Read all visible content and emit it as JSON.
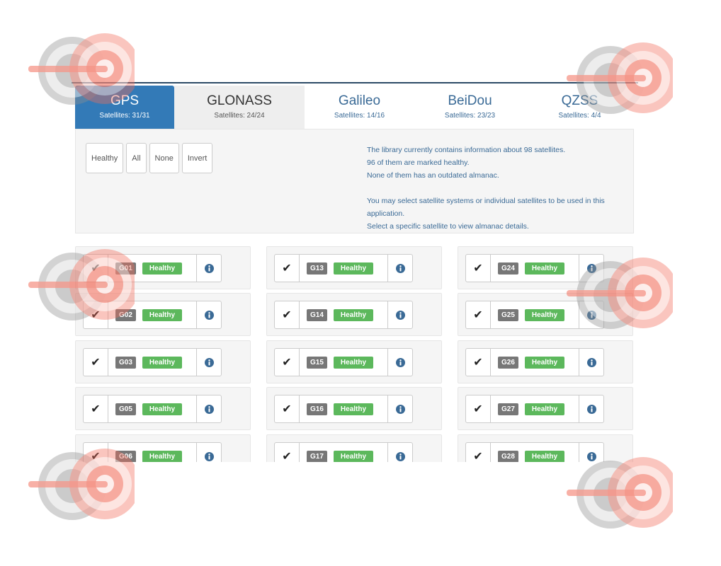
{
  "tabs": [
    {
      "label": "GPS",
      "count": "Satellites: 31/31"
    },
    {
      "label": "GLONASS",
      "count": "Satellites: 24/24"
    },
    {
      "label": "Galileo",
      "count": "Satellites: 14/16"
    },
    {
      "label": "BeiDou",
      "count": "Satellites: 23/23"
    },
    {
      "label": "QZSS",
      "count": "Satellites: 4/4"
    }
  ],
  "filters": [
    "Healthy",
    "All",
    "None",
    "Invert"
  ],
  "info": {
    "line1": "The library currently contains information about 98 satellites.",
    "line2": "96 of them are marked healthy.",
    "line3": "None of them has an outdated almanac.",
    "line4": "You may select satellite systems or individual satellites to be used in this application.",
    "line5": "Select a specific satellite to view almanac details."
  },
  "check_glyph": "✔",
  "health_label": "Healthy",
  "icons": {
    "check": "check-icon",
    "info": "info-circle-icon",
    "watermark": "target-watermark-icon"
  },
  "colors": {
    "accent": "#337ab7",
    "healthy": "#5cb85c",
    "badge": "#777777",
    "watermark": "#f26d5b"
  },
  "satellites": {
    "columns": [
      [
        "G01",
        "G02",
        "G03",
        "G05",
        "G06"
      ],
      [
        "G13",
        "G14",
        "G15",
        "G16",
        "G17"
      ],
      [
        "G24",
        "G25",
        "G26",
        "G27",
        "G28"
      ]
    ]
  }
}
